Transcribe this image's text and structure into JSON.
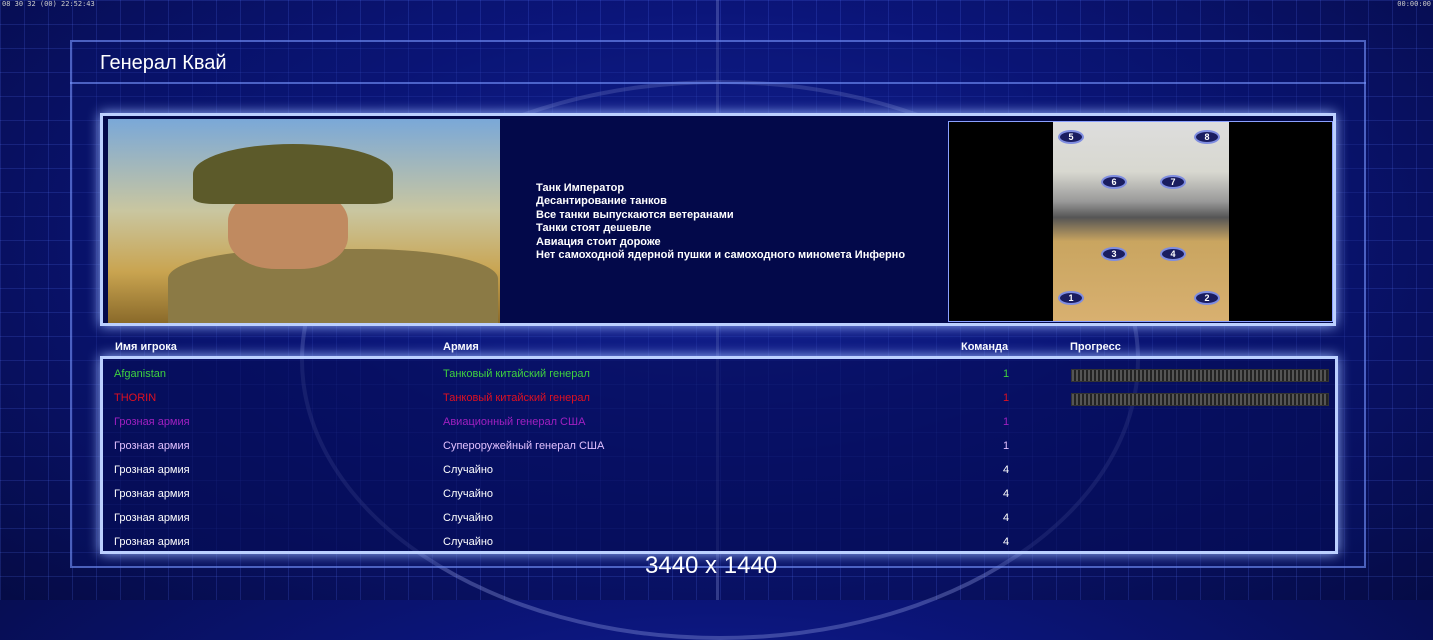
{
  "clock_left": "08 30 32 (00) 22:52:43",
  "clock_right": "00:00:00",
  "general_name": "Генерал Квай",
  "perks": [
    "Танк Император",
    "Десантирование танков",
    "Все танки выпускаются ветеранами",
    "Танки стоят дешевле",
    "Авиация стоит дороже",
    "Нет самоходной ядерной пушки и самоходного миномета Инферно"
  ],
  "map_spots": [
    "5",
    "8",
    "6",
    "7",
    "3",
    "4",
    "1",
    "2"
  ],
  "columns": {
    "player": "Имя игрока",
    "army": "Армия",
    "team": "Команда",
    "progress": "Прогресс"
  },
  "players": [
    {
      "name": "Afganistan",
      "army": "Танковый китайский генерал",
      "team": "1",
      "color": "#3fd23f",
      "progress": true
    },
    {
      "name": "THORIN",
      "army": "Танковый китайский генерал",
      "team": "1",
      "color": "#e01020",
      "progress": true
    },
    {
      "name": "Грозная армия",
      "army": "Авиационный генерал США",
      "team": "1",
      "color": "#a020c0",
      "progress": false
    },
    {
      "name": "Грозная армия",
      "army": "Супероружейный генерал США",
      "team": "1",
      "color": "#e0c0ff",
      "progress": false
    },
    {
      "name": "Грозная армия",
      "army": "Случайно",
      "team": "4",
      "color": "#ffffff",
      "progress": false
    },
    {
      "name": "Грозная армия",
      "army": "Случайно",
      "team": "4",
      "color": "#ffffff",
      "progress": false
    },
    {
      "name": "Грозная армия",
      "army": "Случайно",
      "team": "4",
      "color": "#ffffff",
      "progress": false
    },
    {
      "name": "Грозная армия",
      "army": "Случайно",
      "team": "4",
      "color": "#ffffff",
      "progress": false
    }
  ],
  "resolution": "3440 x 1440"
}
